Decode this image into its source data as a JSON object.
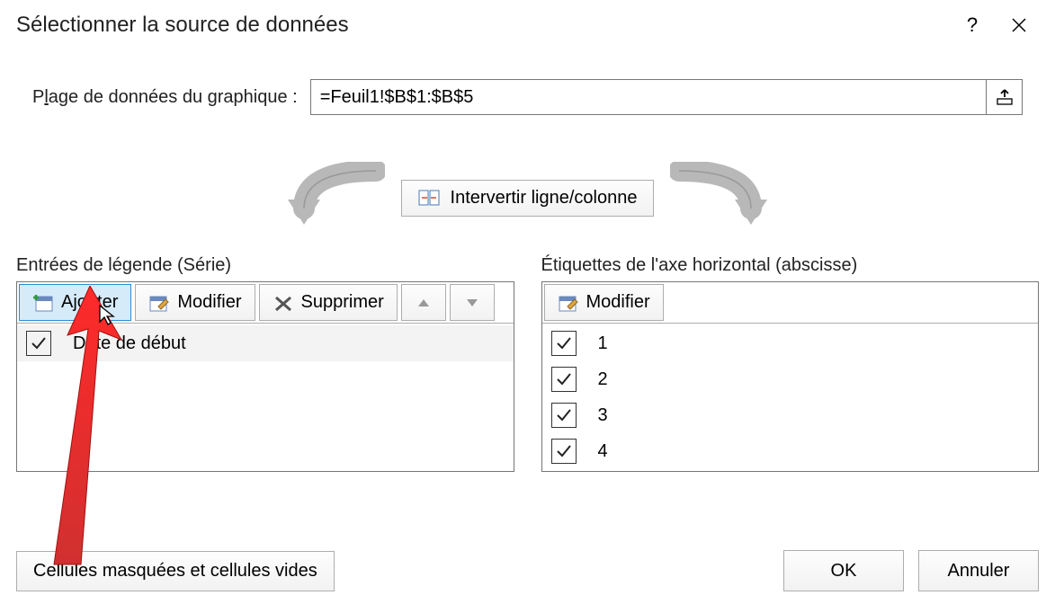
{
  "title": "Sélectionner la source de données",
  "help_glyph": "?",
  "close_glyph": "✕",
  "range": {
    "label_pre": "P",
    "label_u": "l",
    "label_post": "age de données du graphique :",
    "value": "=Feuil1!$B$1:$B$5"
  },
  "swap": {
    "label_pre": "Inter",
    "label_u": "v",
    "label_post": "ertir ligne/colonne"
  },
  "legend": {
    "label_pre": "Entrées de légende (S",
    "label_u": "é",
    "label_post": "rie)",
    "add_pre": "Ajo",
    "add_u": "u",
    "add_post": "ter",
    "edit_pre": "Modifi",
    "edit_u": "e",
    "edit_post": "r",
    "del_pre": "Suppri",
    "del_u": "m",
    "del_post": "er",
    "items": [
      {
        "checked": true,
        "label": "Date de début"
      }
    ]
  },
  "axis": {
    "label_pre": "Étiquettes de l'axe hori",
    "label_u": "z",
    "label_post": "ontal (abscisse)",
    "edit_pre": "Modi",
    "edit_u": "f",
    "edit_post": "ier",
    "items": [
      {
        "checked": true,
        "label": "1"
      },
      {
        "checked": true,
        "label": "2"
      },
      {
        "checked": true,
        "label": "3"
      },
      {
        "checked": true,
        "label": "4"
      }
    ]
  },
  "footer": {
    "hidden_pre": "C",
    "hidden_u": "e",
    "hidden_post": "llules masquées et cellules vides",
    "ok": "OK",
    "cancel": "Annuler"
  }
}
